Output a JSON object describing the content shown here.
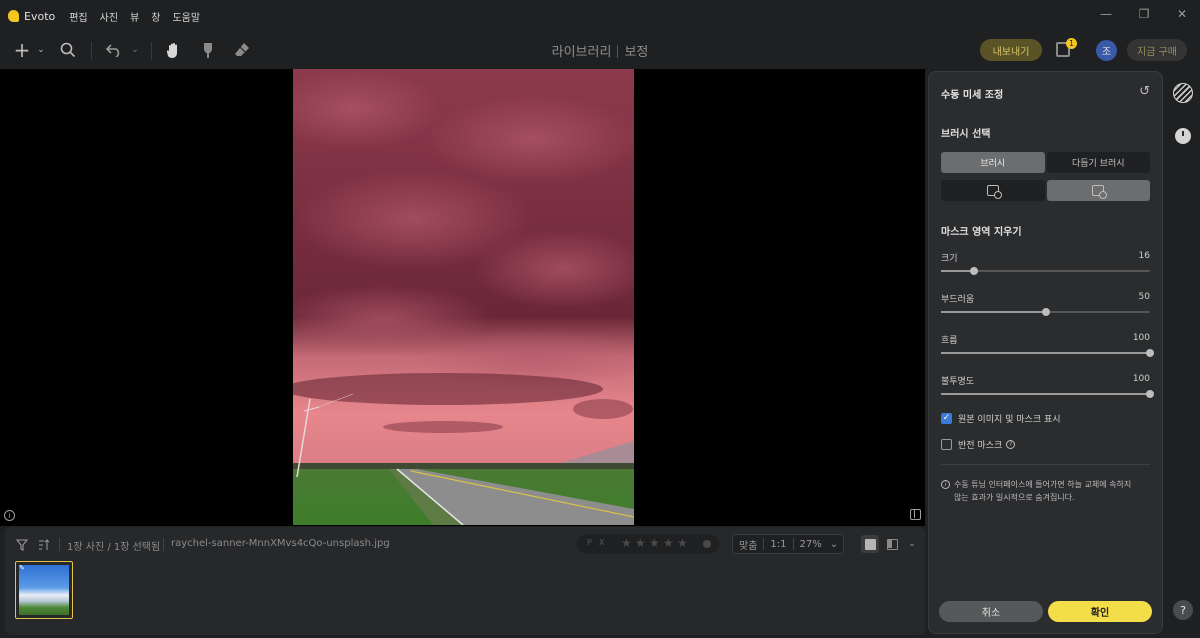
{
  "app": {
    "name": "Evoto",
    "menu": [
      "편집",
      "사진",
      "뷰",
      "창",
      "도움말"
    ]
  },
  "toolbar": {
    "title_library": "라이브러리",
    "title_edit": "보정",
    "export_label": "내보내기",
    "notification_count": "1",
    "avatar_initial": "조",
    "buy_label": "지금 구매"
  },
  "filmstrip": {
    "count_text": "1장 사진 / 1장 선택됨",
    "filename": "raychel-sanner-MnnXMvs4cQo-unsplash.jpg",
    "flags": [
      "P",
      "X"
    ],
    "rating": 0,
    "zoom_fit": "맞춤",
    "zoom_1to1": "1:1",
    "zoom_percent": "27%"
  },
  "panel": {
    "title": "수동 미세 조정",
    "brush_section": "브러시 선택",
    "brush_tabs": [
      "브러시",
      "다듬기 브러시"
    ],
    "mask_section": "마스크 영역 지우기",
    "sliders": [
      {
        "label": "크기",
        "value": 16,
        "max": 100
      },
      {
        "label": "부드러움",
        "value": 50,
        "max": 100
      },
      {
        "label": "흐름",
        "value": 100,
        "max": 100
      },
      {
        "label": "불투명도",
        "value": 100,
        "max": 100
      }
    ],
    "show_original_label": "원본 이미지 및 마스크 표시",
    "show_original_checked": true,
    "invert_mask_label": "반전 마스크",
    "invert_mask_checked": false,
    "note": "수동 튜닝 인터페이스에 들어가면 하늘 교체에 속하지 않는 효과가 일시적으로 숨겨집니다.",
    "cancel_label": "취소",
    "confirm_label": "확인"
  },
  "colors": {
    "accent_yellow": "#f3dd48",
    "checkbox_blue": "#3b7bd9",
    "mask_red": "#a33a4a"
  }
}
